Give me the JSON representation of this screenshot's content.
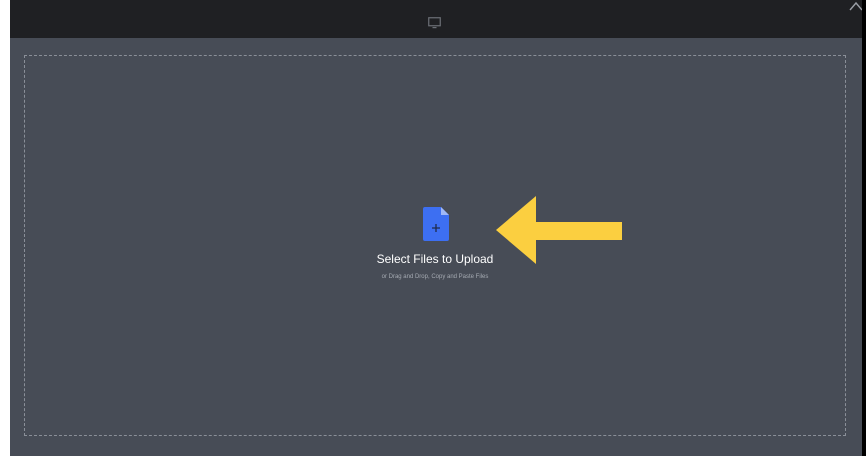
{
  "upload": {
    "title": "Select Files to Upload",
    "subtitle": "or Drag and Drop, Copy and Paste Files"
  },
  "icons": {
    "device": "device-icon",
    "close": "close-icon",
    "file_add": "file-add-icon",
    "arrow": "arrow-left-icon"
  },
  "colors": {
    "background": "#474c56",
    "top_bar": "#1f2023",
    "file_icon": "#3d6ff2",
    "arrow": "#fbcf40"
  }
}
